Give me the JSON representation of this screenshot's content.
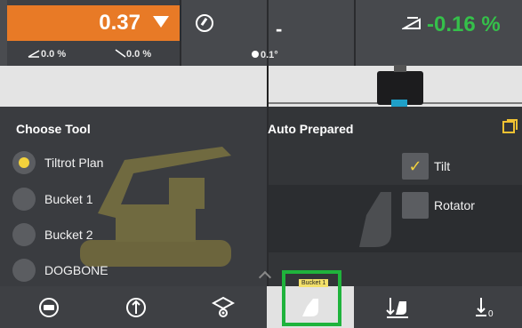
{
  "status": {
    "main_value": "0.37",
    "cross_slope": "0.0 %",
    "main_slope": "0.0 %",
    "bearing": "0.1°",
    "distance_value": "-",
    "grade_value": "-0.16 %"
  },
  "colors": {
    "accent_orange": "#e87a26",
    "positive_green": "#35c04a",
    "selection_yellow": "#f3d23c",
    "highlight_green": "#1fb33c"
  },
  "choose_tool": {
    "title": "Choose Tool",
    "items": [
      {
        "label": "Tiltrot Plan",
        "selected": true
      },
      {
        "label": "Bucket 1",
        "selected": false
      },
      {
        "label": "Bucket 2",
        "selected": false
      },
      {
        "label": "DOGBONE",
        "selected": false
      }
    ]
  },
  "auto_prepared": {
    "title": "Auto Prepared",
    "options": [
      {
        "label": "Tilt",
        "checked": true
      },
      {
        "label": "Rotator",
        "checked": false
      }
    ]
  },
  "toolbar": {
    "buttons": [
      {
        "icon": "keyboard-icon"
      },
      {
        "icon": "guidance-icon"
      },
      {
        "icon": "view-icon"
      },
      {
        "icon": "bucket-icon",
        "active": true,
        "tooltip": "Bucket 1"
      },
      {
        "icon": "bucket-tilt-icon"
      },
      {
        "icon": "bucket-zero-icon"
      }
    ]
  }
}
